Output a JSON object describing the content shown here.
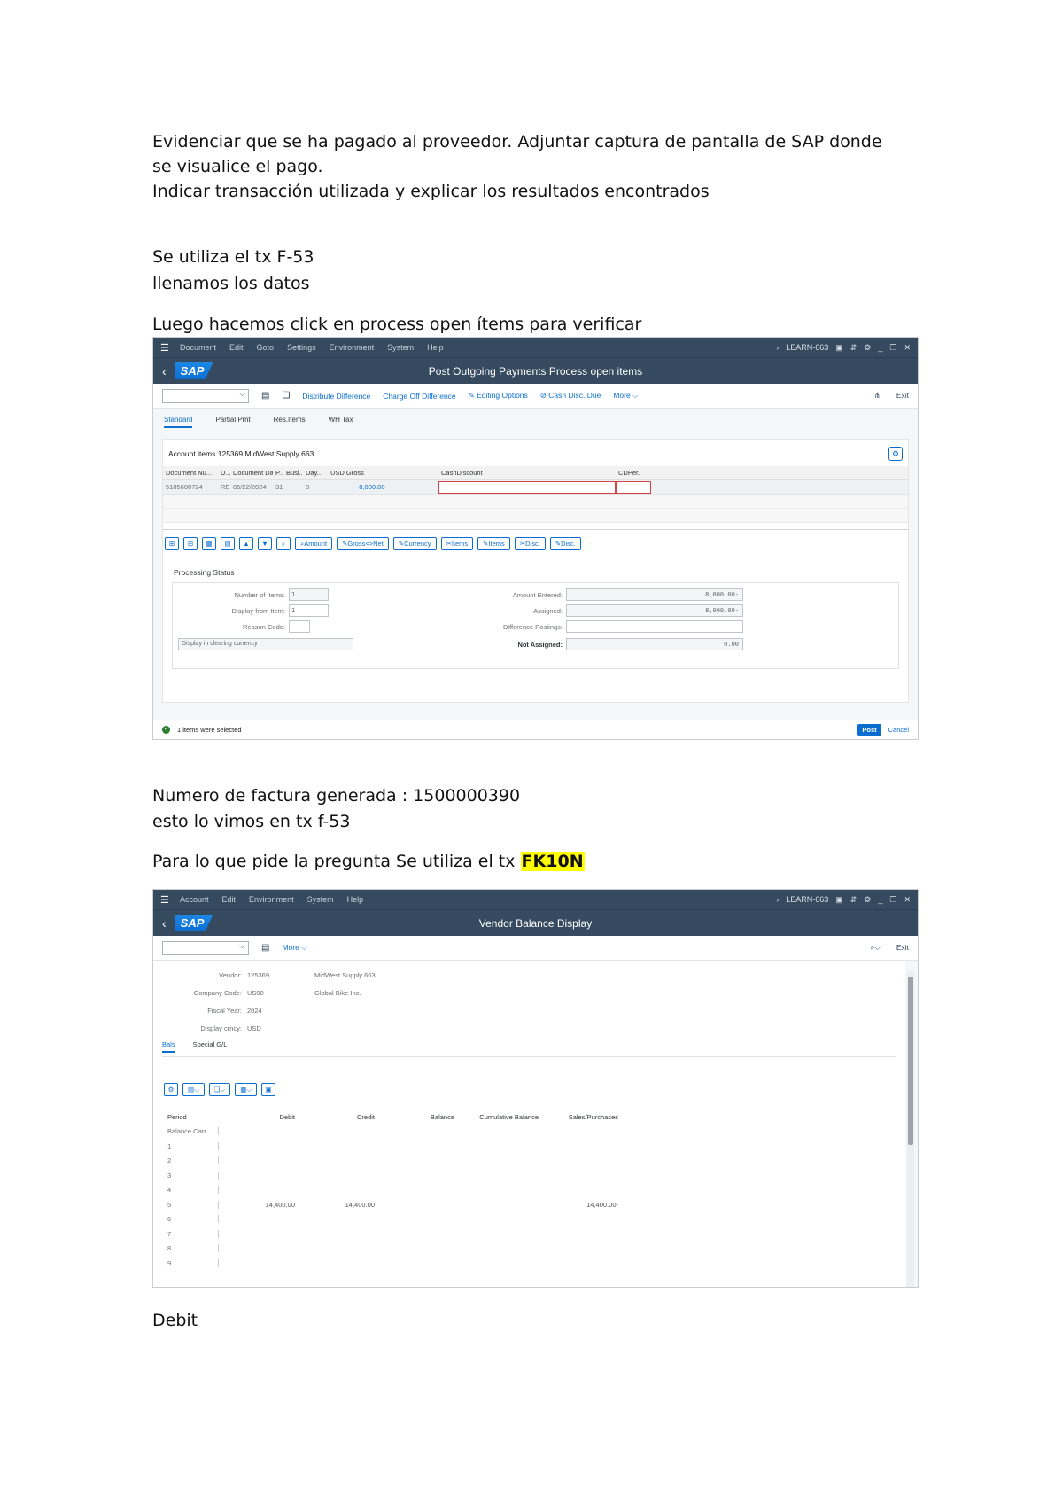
{
  "doc": {
    "para1_line1": "Evidenciar que se ha pagado al proveedor. Adjuntar captura de pantalla de SAP donde",
    "para1_line2": "se visualice el pago.",
    "para1_line3": "Indicar transacción utilizada y explicar los resultados encontrados",
    "line_tx": "Se utiliza el tx F-53",
    "line_fill": "llenamos los datos",
    "line_click": "Luego hacemos click en  process open ítems para verificar",
    "line_invoice": "Numero de factura generada  : 1500000390",
    "line_seen": "esto lo vimos en tx f-53",
    "line_question_prefix": "Para lo que pide la pregunta Se utiliza el tx ",
    "line_question_tx": "FK10N",
    "line_debit": "Debit"
  },
  "screen1": {
    "menu": [
      "Document",
      "Edit",
      "Goto",
      "Settings",
      "Environment",
      "System",
      "Help"
    ],
    "system": "LEARN-663",
    "logo": "SAP",
    "title": "Post Outgoing Payments Process open items",
    "toolbar": {
      "distribute": "Distribute Difference",
      "charge_off": "Charge Off Difference",
      "editing": "Editing Options",
      "cash_disc": "Cash Disc. Due",
      "more": "More",
      "exit": "Exit"
    },
    "tabs": [
      "Standard",
      "Partial Pmt",
      "Res.Items",
      "WH Tax"
    ],
    "account_items_title": "Account items 125369 MidWest Supply 663",
    "columns": [
      "Document Nu...",
      "D...",
      "Document Date",
      "P...",
      "Busi...",
      "Day...",
      "USD Gross",
      "",
      "CashDiscount",
      "CDPer."
    ],
    "row": {
      "doc_no": "5105600724",
      "type": "RE",
      "date": "05/22/2024",
      "p": "31",
      "busi": "",
      "days": "8",
      "gross": "8,000.00-"
    },
    "buttons": {
      "amount": "Amount",
      "gross_net": "Gross<>Net",
      "currency": "Currency",
      "items_x": "Items",
      "items_edit": "Items",
      "disc_x": "Disc.",
      "disc_edit": "Disc."
    },
    "processing_status": "Processing Status",
    "fields": {
      "num_items_label": "Number of Items:",
      "num_items": "1",
      "display_from_label": "Display from Item:",
      "display_from": "1",
      "reason_label": "Reason Code:",
      "reason": "",
      "display_currency": "Display in clearing currency",
      "amount_entered_label": "Amount Entered:",
      "amount_entered": "8,000.00-",
      "assigned_label": "Assigned:",
      "assigned": "8,000.00-",
      "diff_label": "Difference Postings:",
      "diff": "",
      "not_assigned_label": "Not Assigned:",
      "not_assigned": "0.00"
    },
    "status_text": "1 items were selected",
    "post": "Post",
    "cancel": "Cancel"
  },
  "screen2": {
    "menu": [
      "Account",
      "Edit",
      "Environment",
      "System",
      "Help"
    ],
    "system": "LEARN-663",
    "logo": "SAP",
    "title": "Vendor Balance Display",
    "more": "More",
    "exit": "Exit",
    "vendor_label": "Vendor:",
    "vendor": "125369",
    "vendor_name": "MidWest Supply 663",
    "company_label": "Company Code:",
    "company": "US00",
    "company_name": "Global Bike Inc.",
    "fiscal_label": "Fiscal Year:",
    "fiscal": "2024",
    "currency_label": "Display crncy:",
    "currency": "USD",
    "tabs": [
      "Bals",
      "Special G/L"
    ],
    "table_headers": [
      "Period",
      "Debit",
      "Credit",
      "Balance",
      "Cumulative Balance",
      "Sales/Purchases"
    ],
    "rows": [
      {
        "period": "Balance Carr...",
        "debit": "",
        "credit": "",
        "balance": "",
        "cumulative": "",
        "sales": ""
      },
      {
        "period": "1",
        "debit": "",
        "credit": "",
        "balance": "",
        "cumulative": "",
        "sales": ""
      },
      {
        "period": "2",
        "debit": "",
        "credit": "",
        "balance": "",
        "cumulative": "",
        "sales": ""
      },
      {
        "period": "3",
        "debit": "",
        "credit": "",
        "balance": "",
        "cumulative": "",
        "sales": ""
      },
      {
        "period": "4",
        "debit": "",
        "credit": "",
        "balance": "",
        "cumulative": "",
        "sales": ""
      },
      {
        "period": "5",
        "debit": "14,400.00",
        "credit": "14,400.00",
        "balance": "",
        "cumulative": "",
        "sales": "14,400.00-"
      },
      {
        "period": "6",
        "debit": "",
        "credit": "",
        "balance": "",
        "cumulative": "",
        "sales": ""
      },
      {
        "period": "7",
        "debit": "",
        "credit": "",
        "balance": "",
        "cumulative": "",
        "sales": ""
      },
      {
        "period": "8",
        "debit": "",
        "credit": "",
        "balance": "",
        "cumulative": "",
        "sales": ""
      },
      {
        "period": "9",
        "debit": "",
        "credit": "",
        "balance": "",
        "cumulative": "",
        "sales": ""
      }
    ]
  }
}
